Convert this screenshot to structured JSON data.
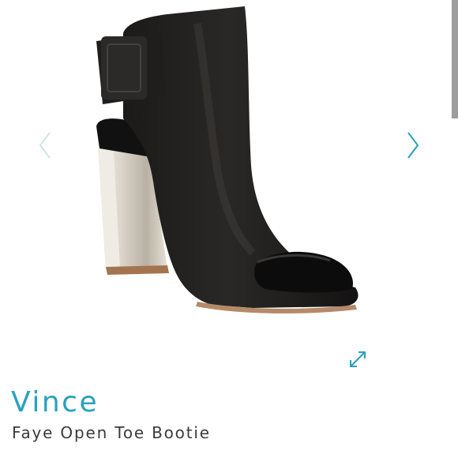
{
  "product": {
    "brand": "Vince",
    "name": "Faye Open Toe Bootie"
  },
  "gallery": {
    "image_subject": "black leather open-toe bootie with buckle strap and metallic block heel",
    "prev_icon": "chevron-left-icon",
    "next_icon": "chevron-right-icon",
    "expand_icon": "expand-arrows-icon"
  },
  "colors": {
    "accent": "#2aa0bf",
    "prev_arrow": "#cfe4ea",
    "text": "#3b3b3b"
  }
}
